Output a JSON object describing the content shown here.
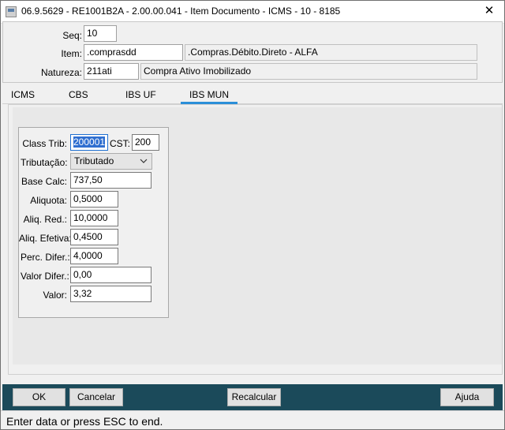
{
  "window": {
    "title": "06.9.5629 - RE1001B2A - 2.00.00.041 - Item Documento - ICMS - 10 - 8185",
    "close_glyph": "✕"
  },
  "header": {
    "seq_label": "Seq:",
    "seq_value": "10",
    "item_label": "Item:",
    "item_code": ".comprasdd",
    "item_desc": ".Compras.Débito.Direto - ALFA",
    "natureza_label": "Natureza:",
    "natureza_code": "211ati",
    "natureza_desc": "Compra Ativo Imobilizado"
  },
  "tabs": [
    {
      "label": "ICMS",
      "active": false
    },
    {
      "label": "CBS",
      "active": false
    },
    {
      "label": "IBS UF",
      "active": false
    },
    {
      "label": "IBS MUN",
      "active": true
    }
  ],
  "form": {
    "class_trib_label": "Class Trib:",
    "class_trib_value": "200001",
    "cst_label": "CST:",
    "cst_value": "200",
    "tributacao_label": "Tributação:",
    "tributacao_value": "Tributado",
    "base_calc_label": "Base Calc:",
    "base_calc_value": "737,50",
    "aliquota_label": "Aliquota:",
    "aliquota_value": "0,5000",
    "aliq_red_label": "Aliq. Red.:",
    "aliq_red_value": "10,0000",
    "aliq_efetiva_label": "Aliq. Efetiva:",
    "aliq_efetiva_value": "0,4500",
    "perc_difer_label": "Perc. Difer.:",
    "perc_difer_value": "4,0000",
    "valor_difer_label": "Valor Difer.:",
    "valor_difer_value": "0,00",
    "valor_label": "Valor:",
    "valor_value": "3,32"
  },
  "buttons": {
    "ok": "OK",
    "cancelar": "Cancelar",
    "recalcular": "Recalcular",
    "ajuda": "Ajuda"
  },
  "status": {
    "text": "Enter data or press ESC to end."
  },
  "colors": {
    "bottom_bar": "#1b4a5a",
    "active_tab_underline": "#2b8fd8",
    "selection": "#2f6fd0"
  }
}
